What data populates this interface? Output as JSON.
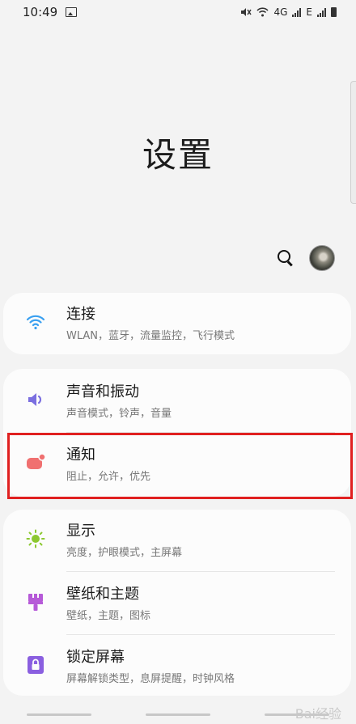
{
  "status_bar": {
    "time": "10:49",
    "network": "4G",
    "network2": "E"
  },
  "header": {
    "title": "设置"
  },
  "toolbar": {
    "search_icon": "search-icon",
    "avatar_icon": "avatar"
  },
  "groups": [
    {
      "items": [
        {
          "title": "连接",
          "subtitle": "WLAN，蓝牙，流量监控，飞行模式",
          "icon": "wifi-icon",
          "color": "#3aa0f0"
        }
      ]
    },
    {
      "items": [
        {
          "title": "声音和振动",
          "subtitle": "声音模式，铃声，音量",
          "icon": "speaker-icon",
          "color": "#7b6fe0"
        },
        {
          "title": "通知",
          "subtitle": "阻止，允许，优先",
          "icon": "notification-icon",
          "color": "#f07070"
        }
      ]
    },
    {
      "items": [
        {
          "title": "显示",
          "subtitle": "亮度，护眼模式，主屏幕",
          "icon": "sun-icon",
          "color": "#8cc830"
        },
        {
          "title": "壁纸和主题",
          "subtitle": "壁纸，主题，图标",
          "icon": "brush-icon",
          "color": "#b65ad8"
        },
        {
          "title": "锁定屏幕",
          "subtitle": "屏幕解锁类型，息屏提醒，时钟风格",
          "icon": "lock-icon",
          "color": "#8a5fe0"
        }
      ]
    }
  ],
  "watermark": "Bai经验"
}
